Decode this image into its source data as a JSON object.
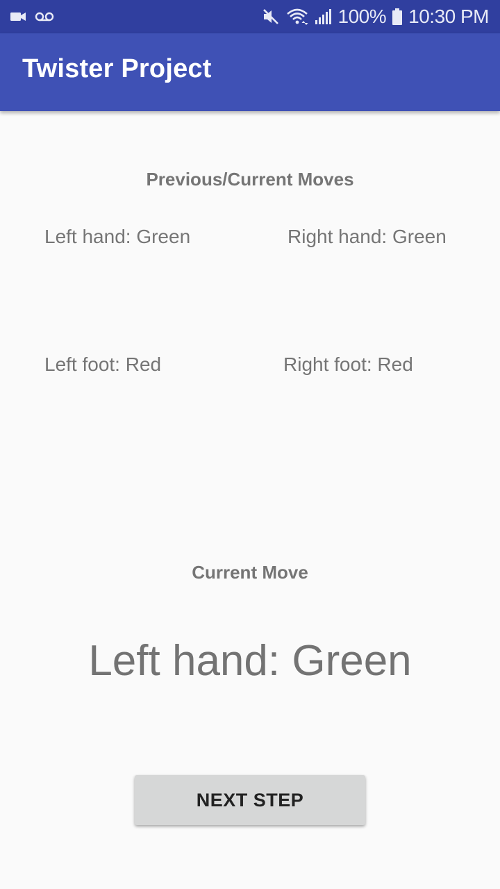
{
  "status_bar": {
    "battery": "100%",
    "time": "10:30 PM",
    "icons": [
      "video-camera-icon",
      "voicemail-icon",
      "mute-icon",
      "wifi-icon",
      "signal-icon",
      "battery-icon"
    ]
  },
  "app_bar": {
    "title": "Twister Project",
    "color": "#3f51b5"
  },
  "previous_moves": {
    "heading": "Previous/Current Moves",
    "left_hand": "Left hand: Green",
    "right_hand": "Right hand: Green",
    "left_foot": "Left foot: Red",
    "right_foot": "Right foot: Red"
  },
  "current_move": {
    "heading": "Current Move",
    "value": "Left hand: Green"
  },
  "next_button": {
    "label": "NEXT STEP"
  }
}
